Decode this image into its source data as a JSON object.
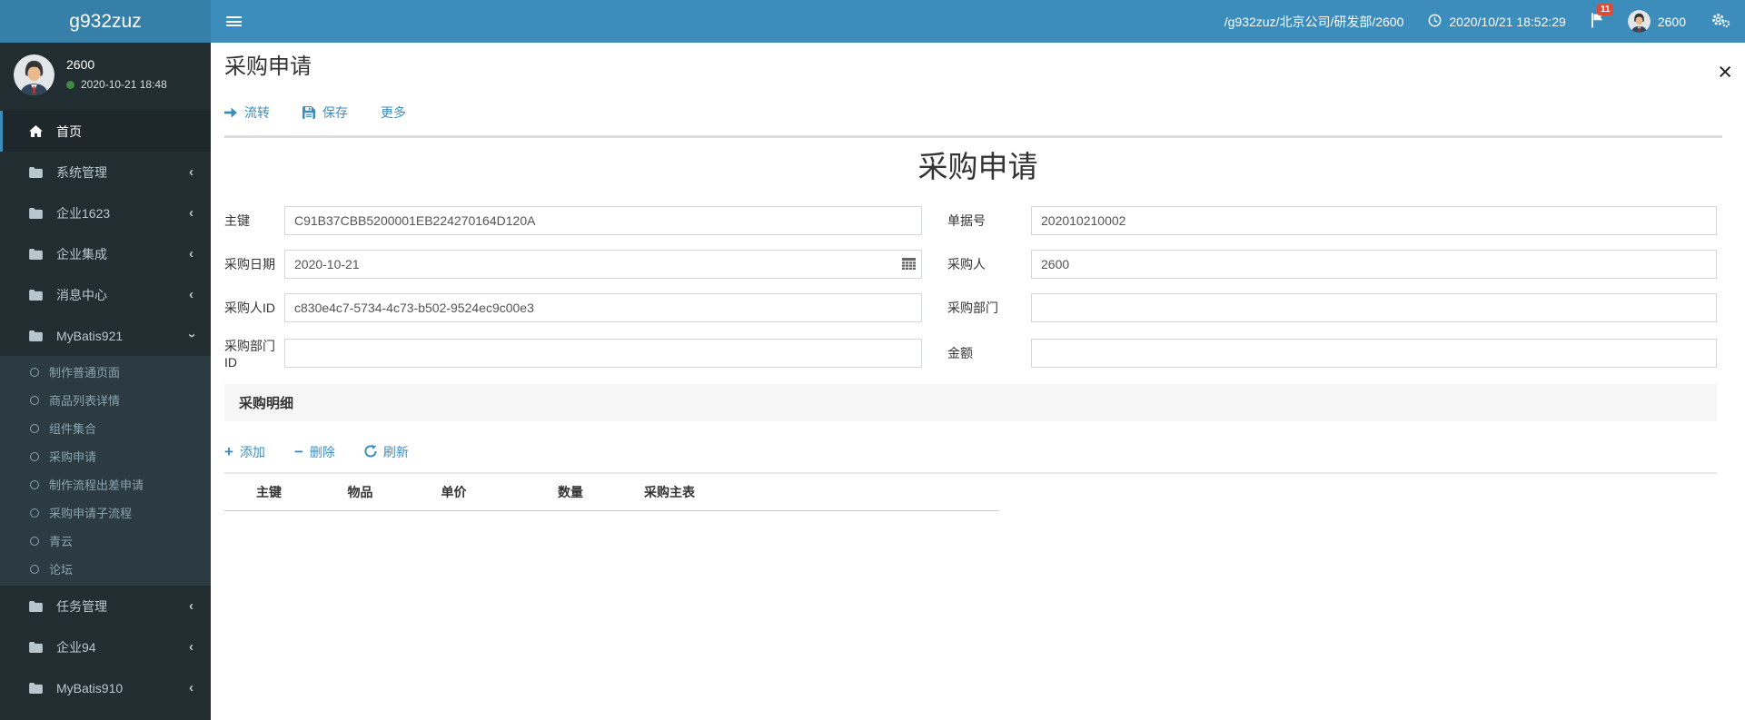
{
  "navbar": {
    "logo": "g932zuz",
    "breadcrumb": "/g932zuz/北京公司/研发部/2600",
    "datetime": "2020/10/21 18:52:29",
    "notification_count": "11",
    "username": "2600",
    "icons": {
      "toggle": "hamburger-icon",
      "time": "clock-icon",
      "notifications": "flag-icon",
      "settings": "gears-icon",
      "user": "avatar"
    }
  },
  "sidebar": {
    "user": {
      "name": "2600",
      "status_time": "2020-10-21 18:48",
      "status": "online"
    },
    "items": [
      {
        "label": "首页",
        "icon": "home-icon",
        "active": true
      },
      {
        "label": "系统管理",
        "icon": "folder-icon",
        "chevron": "left"
      },
      {
        "label": "企业1623",
        "icon": "folder-icon",
        "chevron": "left"
      },
      {
        "label": "企业集成",
        "icon": "folder-icon",
        "chevron": "left"
      },
      {
        "label": "消息中心",
        "icon": "folder-icon",
        "chevron": "left"
      },
      {
        "label": "MyBatis921",
        "icon": "folder-icon",
        "chevron": "down",
        "open": true,
        "children": [
          "制作普通页面",
          "商品列表详情",
          "组件集合",
          "采购申请",
          "制作流程出差申请",
          "采购申请子流程",
          "青云",
          "论坛"
        ]
      },
      {
        "label": "任务管理",
        "icon": "folder-icon",
        "chevron": "left"
      },
      {
        "label": "企业94",
        "icon": "folder-icon",
        "chevron": "left"
      },
      {
        "label": "MyBatis910",
        "icon": "folder-icon",
        "chevron": "left"
      }
    ]
  },
  "content": {
    "page_title": "采购申请",
    "close_glyph": "×",
    "toolbar": [
      {
        "label": "流转",
        "icon": "arrow-right-icon"
      },
      {
        "label": "保存",
        "icon": "save-icon"
      },
      {
        "label": "更多",
        "icon": ""
      }
    ],
    "form_title": "采购申请",
    "rows": [
      {
        "left": {
          "label": "主键",
          "value": "C91B37CBB5200001EB224270164D120A"
        },
        "right": {
          "label": "单据号",
          "value": "202010210002"
        }
      },
      {
        "left": {
          "label": "采购日期",
          "value": "2020-10-21",
          "calendar": true
        },
        "right": {
          "label": "采购人",
          "value": "2600"
        }
      },
      {
        "left": {
          "label": "采购人ID",
          "value": "c830e4c7-5734-4c73-b502-9524ec9c00e3"
        },
        "right": {
          "label": "采购部门",
          "value": ""
        }
      },
      {
        "left": {
          "label": "采购部门ID",
          "value": ""
        },
        "right": {
          "label": "金额",
          "value": ""
        }
      }
    ],
    "detail": {
      "section_title": "采购明细",
      "buttons": [
        {
          "label": "添加",
          "icon": "plus-icon",
          "glyph": "+"
        },
        {
          "label": "删除",
          "icon": "minus-icon",
          "glyph": "−"
        },
        {
          "label": "刷新",
          "icon": "refresh-icon"
        }
      ],
      "table": {
        "columns": [
          "主键",
          "物品",
          "单价",
          "数量",
          "采购主表"
        ],
        "rows": []
      }
    }
  },
  "colors": {
    "navbar": "#3c8dbc",
    "logo_bg": "#367fa9",
    "sidebar": "#222d32",
    "submenu": "#2c3b41",
    "active_item": "#1e282c",
    "link": "#3c8dbc",
    "badge": "#dd4b39",
    "status_green": "#3d8b40",
    "input_border": "#d2d6de"
  }
}
